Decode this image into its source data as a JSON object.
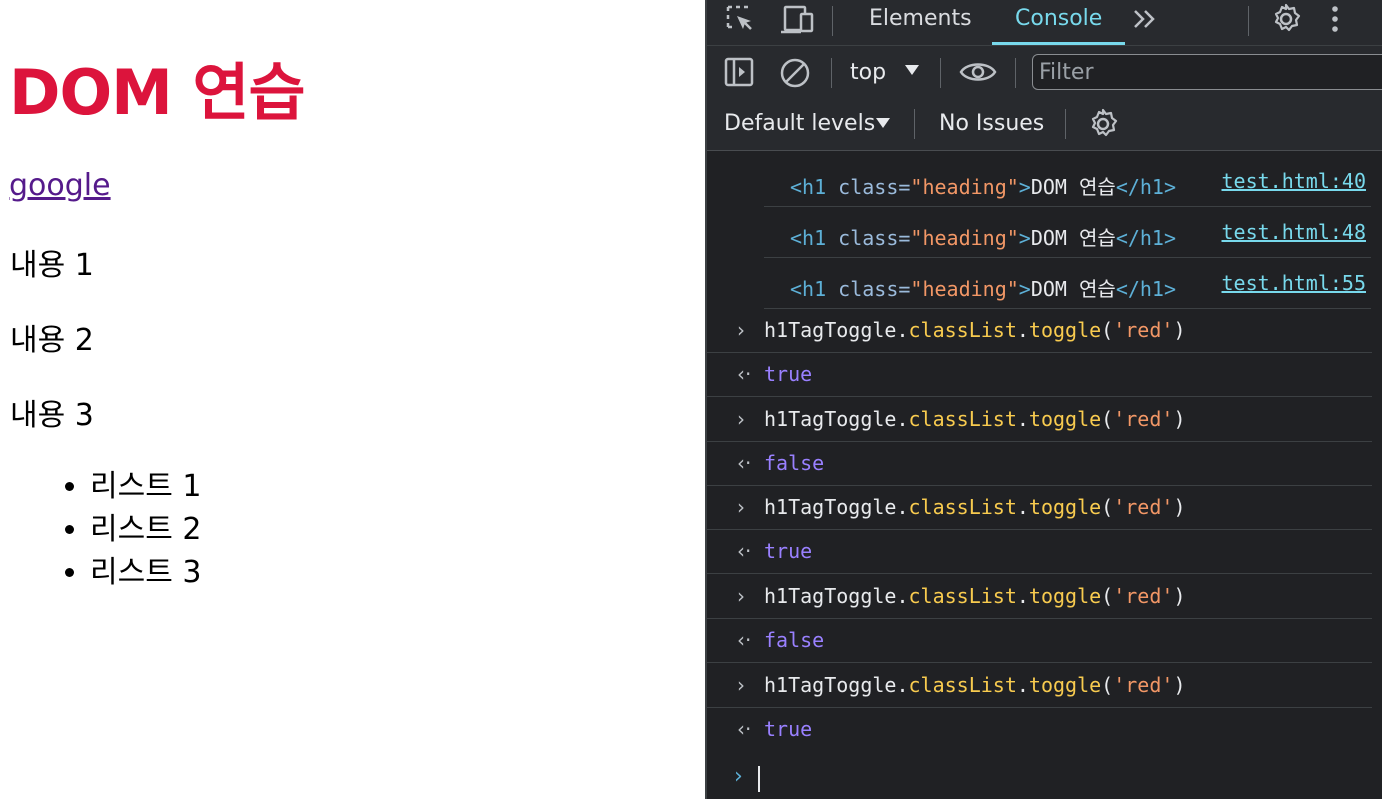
{
  "page": {
    "heading": "DOM 연습",
    "link": "google",
    "paragraphs": [
      "내용 1",
      "내용 2",
      "내용 3"
    ],
    "list": [
      "리스트 1",
      "리스트 2",
      "리스트 3"
    ],
    "heading_color": "#dc143c"
  },
  "devtools": {
    "tabs": [
      "Elements",
      "Console"
    ],
    "active_tab": "Console",
    "more_tabs_glyph": "»",
    "context": "top",
    "filter_placeholder": "Filter",
    "levels": "Default levels",
    "issues": "No Issues",
    "logs": [
      {
        "tag_open": "<h1 ",
        "attr": "class=",
        "val": "\"heading\"",
        "close": ">",
        "text": "DOM 연습",
        "end": "</h1>",
        "source": "test.html:40"
      },
      {
        "tag_open": "<h1 ",
        "attr": "class=",
        "val": "\"heading\"",
        "close": ">",
        "text": "DOM 연습",
        "end": "</h1>",
        "source": "test.html:48"
      },
      {
        "tag_open": "<h1 ",
        "attr": "class=",
        "val": "\"heading\"",
        "close": ">",
        "text": "DOM 연습",
        "end": "</h1>",
        "source": "test.html:55"
      }
    ],
    "command": {
      "obj": "h1TagToggle",
      "dot1": ".",
      "prop": "classList",
      "dot2": ".",
      "method": "toggle",
      "open": "(",
      "arg": "'red'",
      "close": ")"
    },
    "results": [
      "true",
      "false",
      "true",
      "false",
      "true"
    ],
    "input_glyph": "›",
    "result_glyph": "‹·"
  }
}
